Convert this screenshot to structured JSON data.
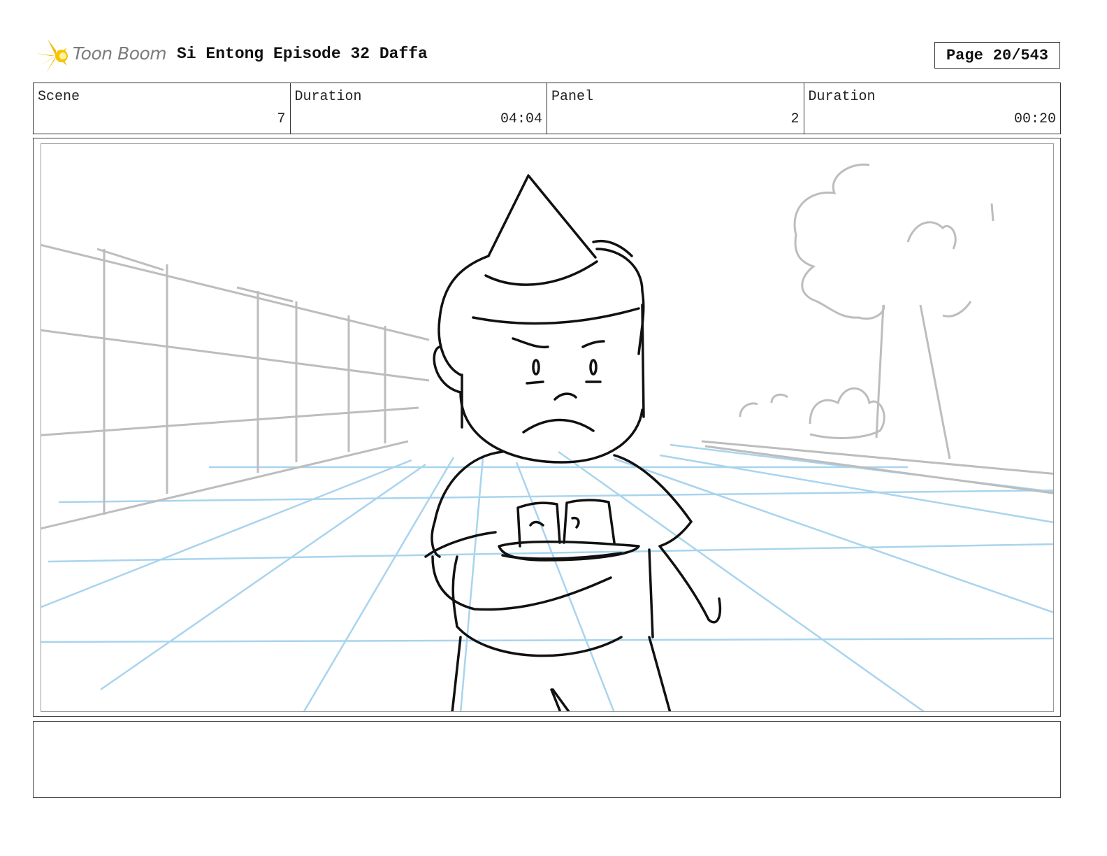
{
  "header": {
    "brand": "Toon Boom",
    "project_title": "Si Entong Episode 32 Daffa",
    "page_label": "Page",
    "page_value": "20/543"
  },
  "info": {
    "scene_label": "Scene",
    "scene_value": "7",
    "scene_duration_label": "Duration",
    "scene_duration_value": "04:04",
    "panel_label": "Panel",
    "panel_value": "2",
    "panel_duration_label": "Duration",
    "panel_duration_value": "00:20"
  },
  "notes": {
    "text": ""
  },
  "colors": {
    "perspective_grid": "#a9d4ee",
    "background_sketch": "#bdbdbd",
    "character_ink": "#111111",
    "logo_star": "#f5b800"
  },
  "icons": {
    "logo": "toon-boom-star-logo"
  }
}
